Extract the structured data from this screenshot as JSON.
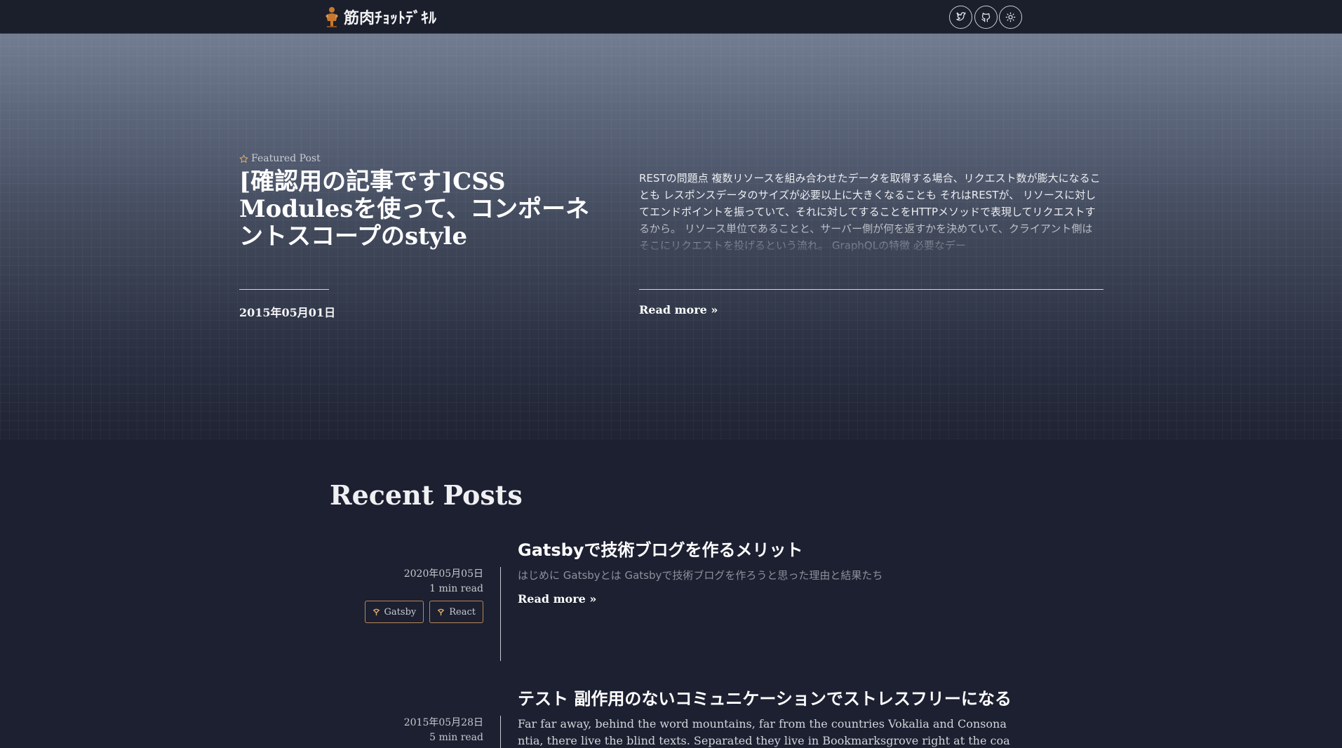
{
  "header": {
    "site_title": "筋肉ﾁｮｯﾄﾃﾞｷﾙ",
    "logo_icon": "muscle-man-logo",
    "buttons": [
      {
        "icon": "twitter-icon"
      },
      {
        "icon": "github-icon"
      },
      {
        "icon": "sun-icon"
      }
    ]
  },
  "featured": {
    "label": "Featured Post",
    "title": "[確認用の記事です]CSS Modulesを使って、コンポーネントスコープのstyle",
    "date": "2015年05月01日",
    "excerpt": "RESTの問題点 複数リソースを組み合わせたデータを取得する場合、リクエスト数が膨大になることも レスポンスデータのサイズが必要以上に大きくなることも それはRESTが、 リソースに対してエンドポイントを振っていて、それに対してすることをHTTPメソッドで表現してリクエストするから。 リソース単位であることと、サーバー側が何を返すかを決めていて、クライアント側はそこにリクエストを投げるという流れ。 GraphQLの特徴 必要なデー",
    "read_more": "Read more »"
  },
  "recent": {
    "heading": "Recent Posts",
    "posts": [
      {
        "title": "Gatsbyで技術ブログを作るメリット",
        "date": "2020年05月05日",
        "read_time": "1 min read",
        "excerpt": "はじめに Gatsbyとは Gatsbyで技術ブログを作ろうと思った理由と結果たち",
        "read_more": "Read more »",
        "tags": [
          "Gatsby",
          "React"
        ]
      },
      {
        "title": "テスト 副作用のないコミュニケーションでストレスフリーになる",
        "date": "2015年05月28日",
        "read_time": "5 min read",
        "excerpt": "Far far away, behind the word mountains, far from the countries Vokalia and Consonantia, there live the blind texts. Separated they live in Bookmarksgrove right at the coast of th"
      }
    ]
  },
  "colors": {
    "background": "#1c2030",
    "header": "#1b1f2c",
    "tag_border": "#b9875a"
  }
}
